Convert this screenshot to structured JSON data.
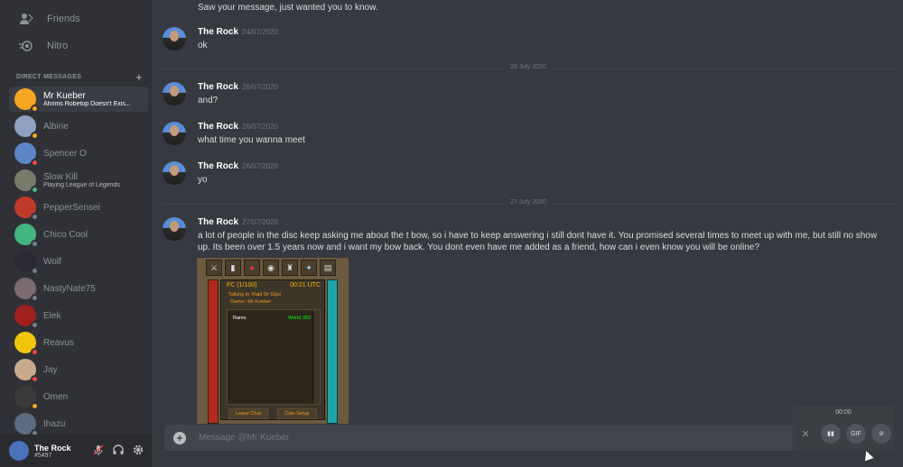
{
  "sidebar": {
    "nav": [
      {
        "label": "Friends",
        "icon": "friends-icon"
      },
      {
        "label": "Nitro",
        "icon": "nitro-icon"
      }
    ],
    "dm_header": "DIRECT MESSAGES",
    "dm_add": "+",
    "dms": [
      {
        "name": "Mr Kueber",
        "sub": "Ahrims Robetop Doesn't Exis...",
        "color": "#f5a623",
        "status": "idle",
        "active": true
      },
      {
        "name": "Albirie",
        "sub": "",
        "color": "#8ea2c0",
        "status": "idle"
      },
      {
        "name": "Spencer O",
        "sub": "",
        "color": "#5d84c4",
        "status": "dnd"
      },
      {
        "name": "Slow Kill",
        "sub": "Playing League of Legends",
        "color": "#7a7a6a",
        "status": "online"
      },
      {
        "name": "PepperSensei",
        "sub": "",
        "color": "#c0392b",
        "status": "offline"
      },
      {
        "name": "Chico Cool",
        "sub": "",
        "color": "#43b581",
        "status": "offline"
      },
      {
        "name": "Wolf",
        "sub": "",
        "color": "#2a2a35",
        "status": "offline"
      },
      {
        "name": "NastyNate75",
        "sub": "",
        "color": "#7b6a6f",
        "status": "offline"
      },
      {
        "name": "Elek",
        "sub": "",
        "color": "#a02020",
        "status": "offline"
      },
      {
        "name": "Reavus",
        "sub": "",
        "color": "#f1c40f",
        "status": "dnd"
      },
      {
        "name": "Jay",
        "sub": "",
        "color": "#c9a98c",
        "status": "dnd"
      },
      {
        "name": "Omen",
        "sub": "",
        "color": "#3a3a3a",
        "status": "idle"
      },
      {
        "name": "Ihazu",
        "sub": "",
        "color": "#5c6b80",
        "status": "offline"
      }
    ]
  },
  "user": {
    "name": "The Rock",
    "tag": "#5497"
  },
  "messages": [
    {
      "author": "",
      "ts": "",
      "text": "Saw your message, just wanted you to know."
    },
    {
      "author": "The Rock",
      "ts": "24/07/2020",
      "text": "ok"
    },
    {
      "author": "The Rock",
      "ts": "26/07/2020",
      "text": "and?"
    },
    {
      "author": "The Rock",
      "ts": "26/07/2020",
      "text": "what time you wanna meet"
    },
    {
      "author": "The Rock",
      "ts": "26/07/2020",
      "text": "yo"
    },
    {
      "author": "The Rock",
      "ts": "27/07/2020",
      "text": "a lot of people in the disc keep asking me about the t bow, so i have to keep answering i still dont have it. You promised several times to meet up with me, but still no show up. Its been over 1.5 years now and i want my bow back. You dont even have me added as a friend, how can i even know you will be online?"
    }
  ],
  "dividers": [
    "26 July 2020",
    "27 July 2020"
  ],
  "game": {
    "fc": "FC (1/100)",
    "utc": "00:21 UTC",
    "talking": "Talking in: Raid Or Gtyo",
    "owner": "Owner: Mr Kueber",
    "rank": "Rares",
    "world": "World 350",
    "leave": "Leave Chat",
    "setup": "Clan Setup"
  },
  "composer": {
    "placeholder": "Message @Mr Kueber"
  },
  "overlay": {
    "timer": "00:00",
    "close": "✕",
    "gif": "GIF"
  }
}
